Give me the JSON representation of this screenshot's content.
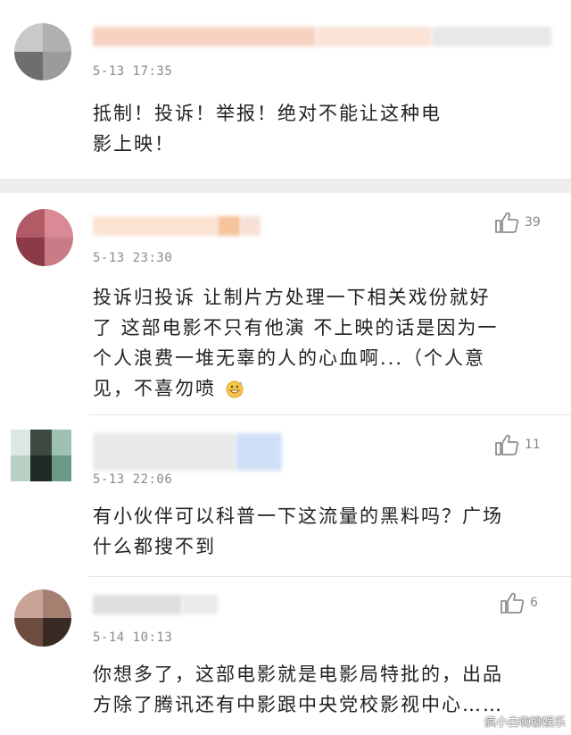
{
  "comments": [
    {
      "time": "5-13 17:35",
      "text_lines": [
        "抵制！投诉！举报！绝对不能让这种电",
        "影上映！"
      ],
      "likes": "",
      "name_colors": [
        "#f7d2c2",
        "#fbe2d7",
        "#e8e8e8"
      ],
      "avatar_colors": [
        "#c9c9c9",
        "#9b9b9b",
        "#6e6e6e",
        "#bdbdbd"
      ]
    },
    {
      "time": "5-13 23:30",
      "text_lines": [
        "投诉归投诉 让制片方处理一下相关戏份就好",
        "了 这部电影不只有他演 不上映的话是因为一",
        "个人浪费一堆无辜的人的心血啊...（个人意",
        "见，不喜勿喷"
      ],
      "likes": "39",
      "name_colors": [
        "#fbe3d2",
        "#f8d6bf",
        "#f6c39d",
        "#f7e0d6"
      ],
      "avatar_colors": [
        "#b35a67",
        "#d98a94",
        "#8a3b45",
        "#c97c86"
      ]
    },
    {
      "time": "5-13 22:06",
      "text_lines": [
        "有小伙伴可以科普一下这流量的黑料吗？广场",
        "什么都搜不到"
      ],
      "likes": "11",
      "name_colors": [
        "#e9e9ea",
        "#dfe6ef",
        "#cfe0f6"
      ],
      "avatar_colors": [
        "#6c9a86",
        "#2f3a33",
        "#9fc1b1",
        "#485a50"
      ]
    },
    {
      "time": "5-14 10:13",
      "text_lines": [
        "你想多了，这部电影就是电影局特批的，出品",
        "方除了腾讯还有中影跟中央党校影视中心……"
      ],
      "likes": "6",
      "name_colors": [
        "#dedede",
        "#eaeaea"
      ],
      "avatar_colors": [
        "#a57f6f",
        "#6d4d40",
        "#c8a496",
        "#3a2a24"
      ]
    }
  ],
  "emoji_icon": "grin-sweat-emoji-icon",
  "watermark": "疯小白嗨聊娱乐"
}
